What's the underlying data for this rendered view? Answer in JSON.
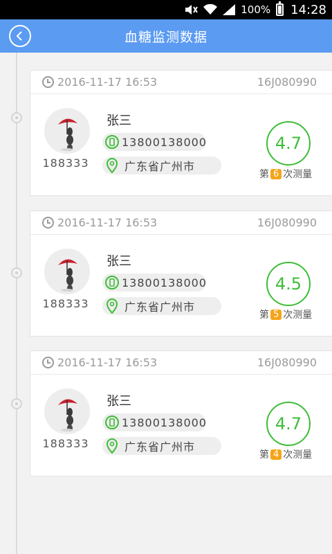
{
  "status_bar": {
    "battery": "100%",
    "time": "14:28",
    "icons": [
      "mute-icon",
      "wifi-icon",
      "signal-icon",
      "battery-icon"
    ]
  },
  "header": {
    "title": "血糖监测数据",
    "back_icon": "chevron-left-icon"
  },
  "colors": {
    "accent": "#5b9bf1",
    "value_green": "#3dbd36",
    "count_orange": "#f5a418"
  },
  "records": [
    {
      "datetime": "2016-11-17 16:53",
      "device_id": "16J080990",
      "name": "张三",
      "user_id": "188333",
      "phone": "13800138000",
      "address": "广东省广州市",
      "value": "4.7",
      "count_prefix": "第",
      "count": "6",
      "count_suffix": "次测量"
    },
    {
      "datetime": "2016-11-17 16:53",
      "device_id": "16J080990",
      "name": "张三",
      "user_id": "188333",
      "phone": "13800138000",
      "address": "广东省广州市",
      "value": "4.5",
      "count_prefix": "第",
      "count": "5",
      "count_suffix": "次测量"
    },
    {
      "datetime": "2016-11-17 16:53",
      "device_id": "16J080990",
      "name": "张三",
      "user_id": "188333",
      "phone": "13800138000",
      "address": "广东省广州市",
      "value": "4.7",
      "count_prefix": "第",
      "count": "4",
      "count_suffix": "次测量"
    }
  ]
}
